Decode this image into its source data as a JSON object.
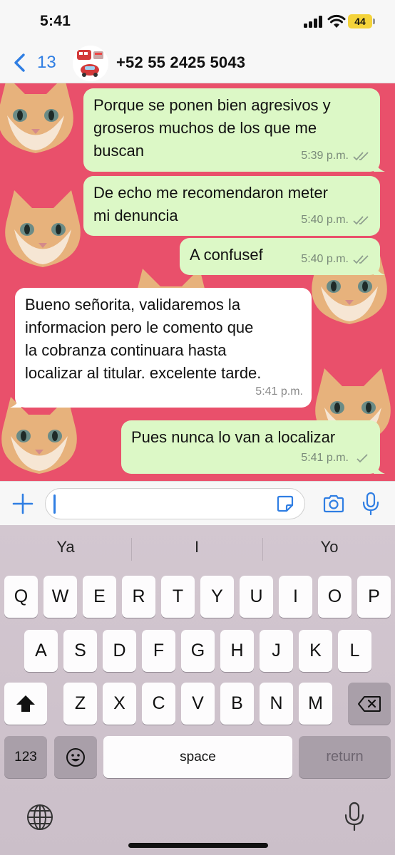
{
  "status_bar": {
    "time": "5:41",
    "battery_level": "44",
    "icons": [
      "cellular-signal-icon",
      "wifi-icon",
      "battery-icon"
    ]
  },
  "header": {
    "back_count": "13",
    "contact_name": "+52 55 2425 5043",
    "icons": [
      "chevron-left-icon",
      "avatar"
    ]
  },
  "messages": [
    {
      "direction": "outgoing",
      "text": "Porque se ponen bien agresivos y\ngroseros muchos de los que me\nbuscan",
      "time": "5:39 p.m.",
      "status": "read"
    },
    {
      "direction": "outgoing",
      "text": "De echo me recomendaron meter\nmi denuncia",
      "time": "5:40 p.m.",
      "status": "read"
    },
    {
      "direction": "outgoing",
      "text": "A confusef",
      "time": "5:40 p.m.",
      "status": "read"
    },
    {
      "direction": "incoming",
      "text": "Bueno señorita, validaremos la\ninformacion pero le comento que\nla cobranza continuara hasta\nlocalizar al titular. excelente tarde.",
      "time": "5:41 p.m."
    },
    {
      "direction": "outgoing",
      "text": "Pues nunca lo van a localizar",
      "time": "5:41 p.m.",
      "status": "sent"
    }
  ],
  "input_bar": {
    "message_value": "",
    "icons": [
      "plus-icon",
      "sticker-icon",
      "camera-icon",
      "microphone-icon"
    ]
  },
  "keyboard": {
    "suggestions": [
      "Ya",
      "I",
      "Yo"
    ],
    "row1": [
      "Q",
      "W",
      "E",
      "R",
      "T",
      "Y",
      "U",
      "I",
      "O",
      "P"
    ],
    "row2": [
      "A",
      "S",
      "D",
      "F",
      "G",
      "H",
      "J",
      "K",
      "L"
    ],
    "row3": [
      "Z",
      "X",
      "C",
      "V",
      "B",
      "N",
      "M"
    ],
    "numbers_label": "123",
    "space_label": "space",
    "return_label": "return",
    "icons": [
      "shift-icon",
      "delete-icon",
      "emoji-icon",
      "globe-icon",
      "dictation-icon"
    ]
  },
  "colors": {
    "chat_background": "#e9506b",
    "outgoing_bubble": "#dcf8c6",
    "incoming_bubble": "#ffffff",
    "accent_blue": "#2f7ee3",
    "battery_yellow": "#f4d33a"
  }
}
